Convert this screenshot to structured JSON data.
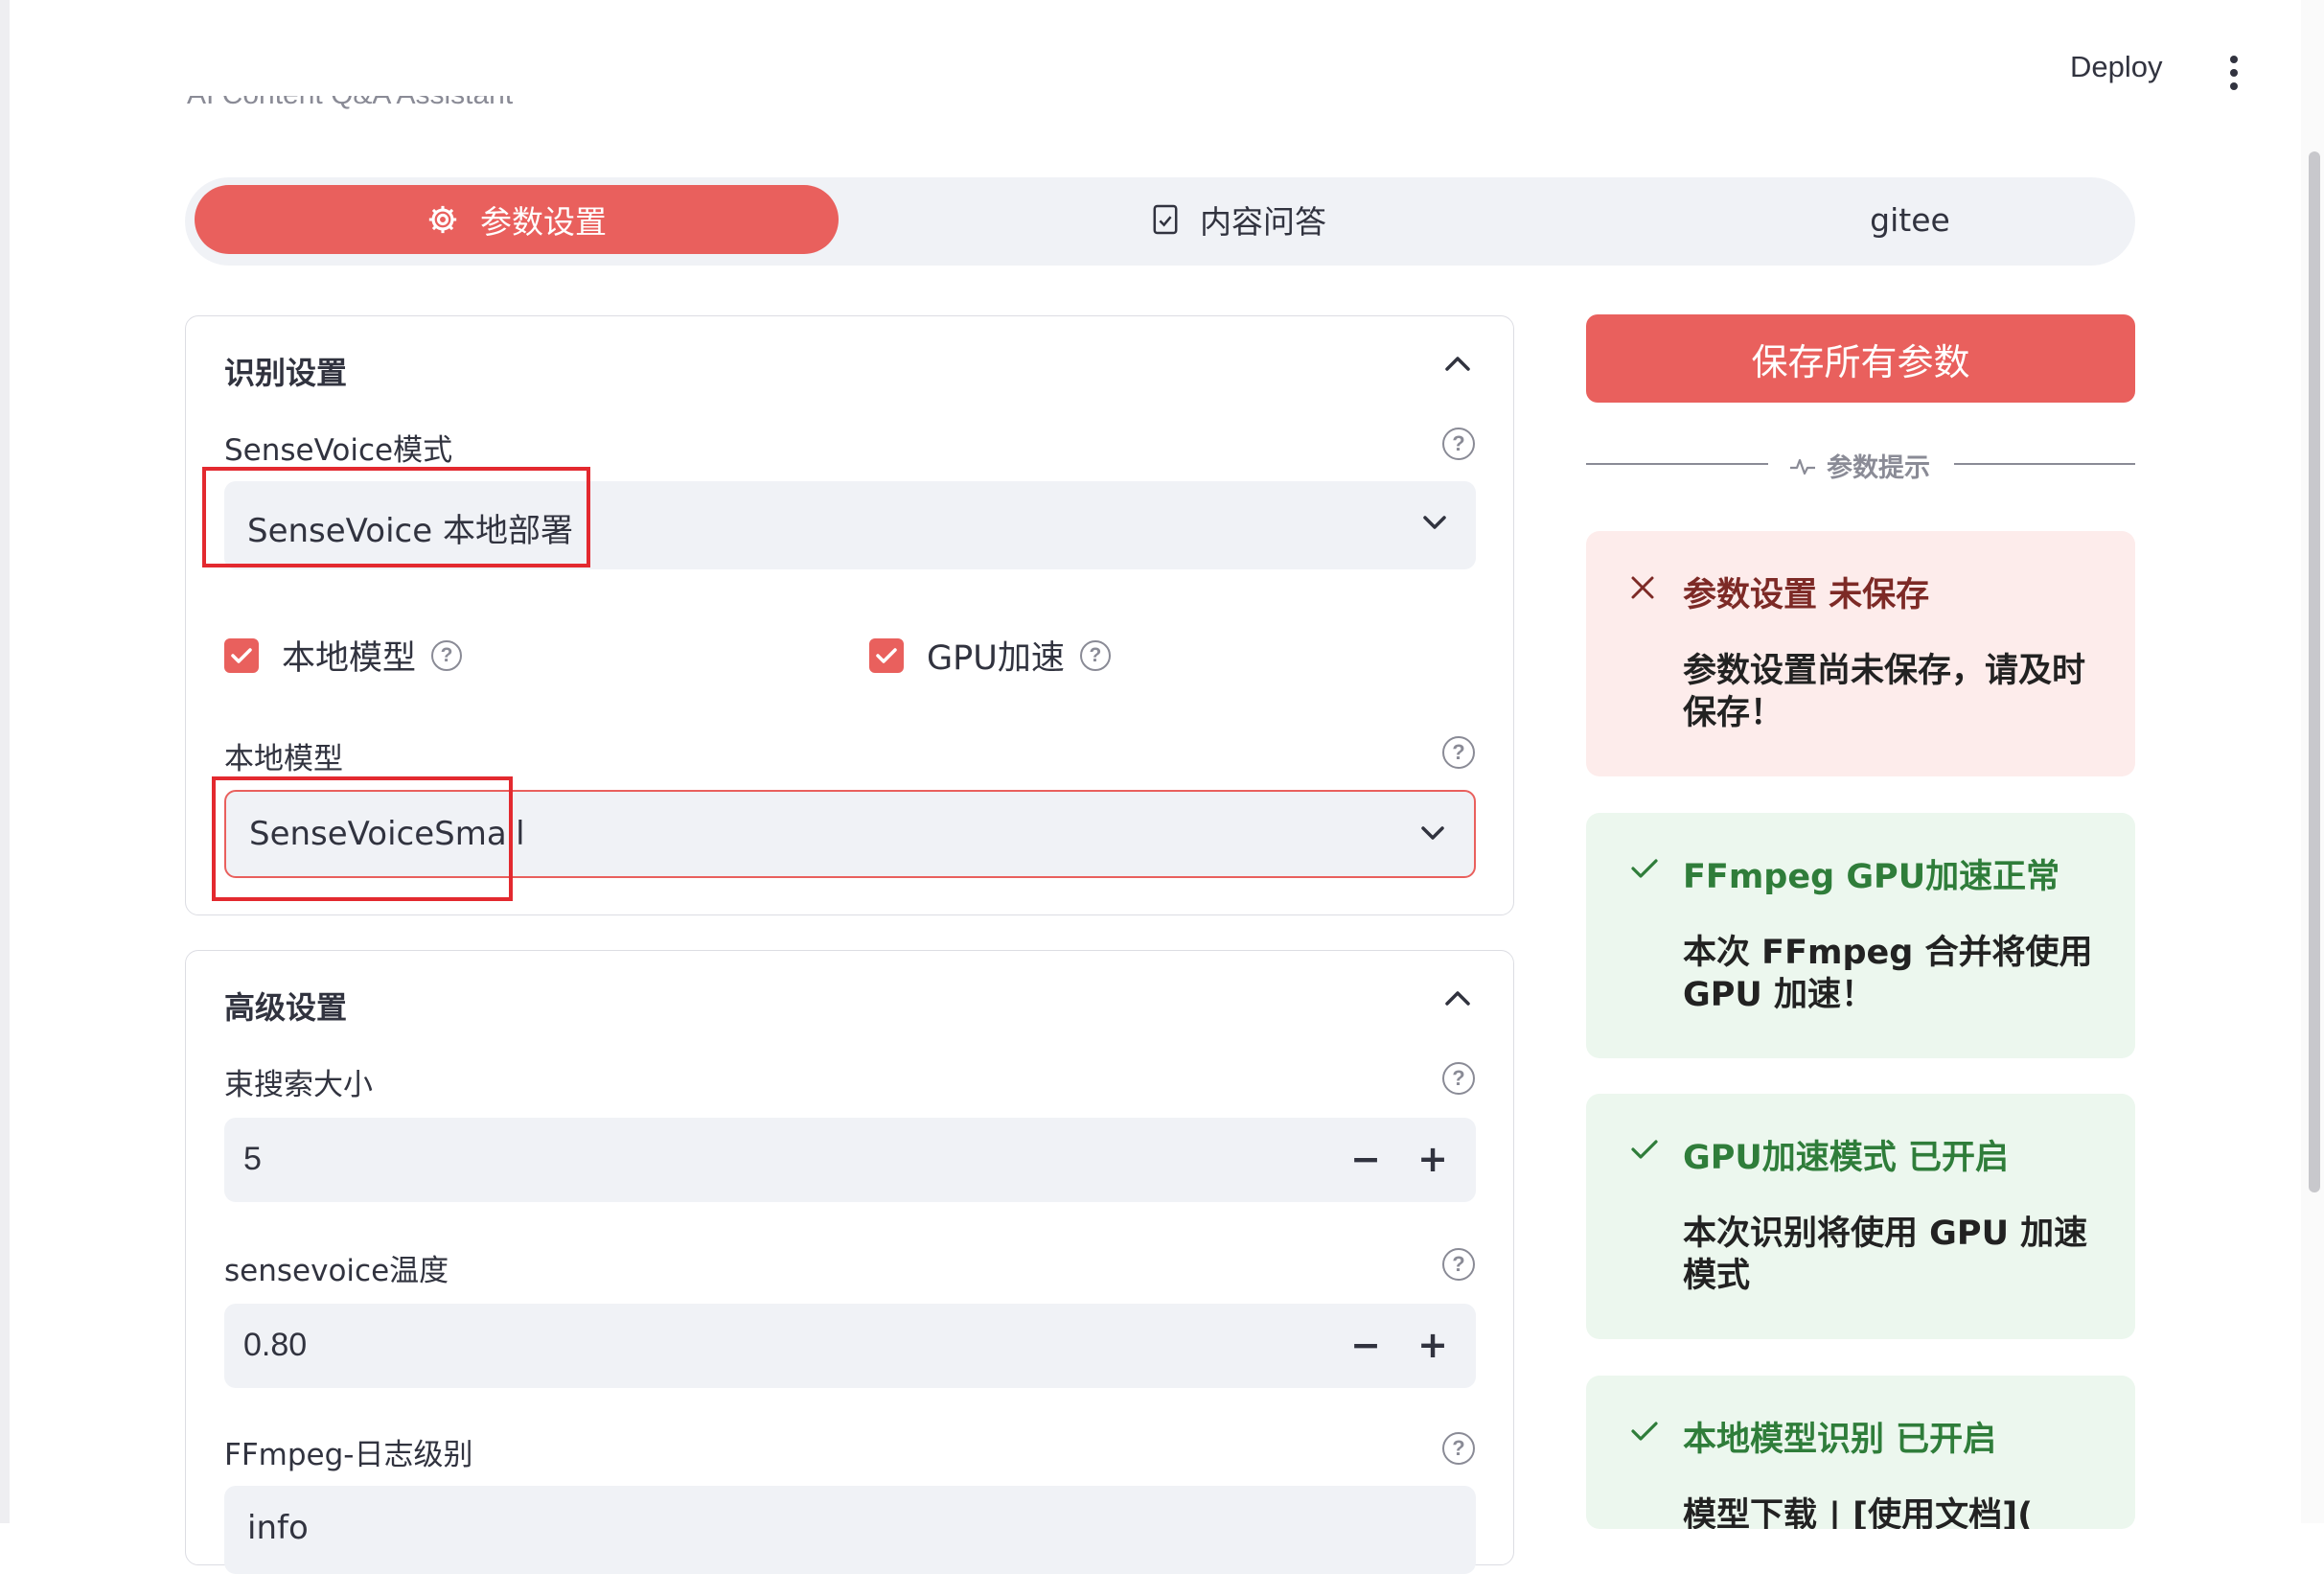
{
  "header": {
    "deploy_label": "Deploy",
    "subtitle": "AI Content Q&A Assistant"
  },
  "tabs": [
    {
      "label": "参数设置",
      "icon": "gear-icon",
      "active": true
    },
    {
      "label": "内容问答",
      "icon": "document-check-icon",
      "active": false
    },
    {
      "label": "gitee",
      "icon": "",
      "active": false
    }
  ],
  "recognition": {
    "title": "识别设置",
    "mode_label": "SenseVoice模式",
    "mode_value": "SenseVoice 本地部署",
    "local_model_checkbox": "本地模型",
    "local_model_checked": true,
    "gpu_checkbox": "GPU加速",
    "gpu_checked": true,
    "model_label": "本地模型",
    "model_value": "SenseVoiceSmall"
  },
  "advanced": {
    "title": "高级设置",
    "beam_label": "束搜索大小",
    "beam_value": "5",
    "temp_label": "sensevoice温度",
    "temp_value": "0.80",
    "ffmpeg_label": "FFmpeg-日志级别",
    "ffmpeg_value": "info"
  },
  "right": {
    "save_label": "保存所有参数",
    "divider_label": "参数提示",
    "alerts": [
      {
        "type": "error",
        "title": "参数设置 未保存",
        "body": "参数设置尚未保存，请及时保存！"
      },
      {
        "type": "success",
        "title": "FFmpeg GPU加速正常",
        "body": "本次 FFmpeg 合并将使用 GPU 加速！"
      },
      {
        "type": "success",
        "title": "GPU加速模式 已开启",
        "body": "本次识别将使用 GPU 加速模式"
      },
      {
        "type": "success",
        "title": "本地模型识别 已开启",
        "body": "模型下载 | [使用文档]("
      }
    ]
  },
  "colors": {
    "accent": "#e9605d",
    "highlight_box": "#e3292f",
    "error_bg": "#fdeceb",
    "success_bg": "#ecf7ee",
    "success_text": "#2f7d3a",
    "tab_bg": "#f0f2f6"
  }
}
